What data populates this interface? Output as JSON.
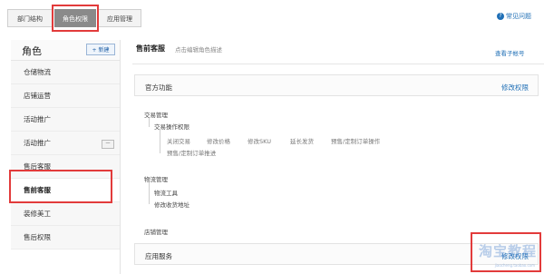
{
  "tabs": [
    "部门结构",
    "角色权限",
    "应用管理"
  ],
  "help_text": "常见问题",
  "sidebar": {
    "title": "角色",
    "new_button": "+ 新建",
    "items": [
      {
        "label": "仓储物流"
      },
      {
        "label": "店铺运营"
      },
      {
        "label": "活动推广"
      },
      {
        "label": "活动推广",
        "mini": "一"
      },
      {
        "label": "售后客服"
      },
      {
        "label": "售前客服"
      },
      {
        "label": "装修美工"
      },
      {
        "label": "售后权限"
      }
    ]
  },
  "main": {
    "title": "售前客服",
    "desc": "点击编辑角色描述",
    "view_sub": "查看子帐号",
    "official": {
      "label": "官方功能",
      "link": "修改权限"
    },
    "trade": {
      "group": "交易管理",
      "sub": "交易操作权限",
      "row1": [
        "关闭交易",
        "修改价格",
        "修改SKU",
        "延长发货",
        "预售/定制订单操作"
      ],
      "row2": "预售/定制订单推进"
    },
    "logistics": {
      "group": "物流管理",
      "items": [
        "物流工具",
        "修改收货地址"
      ]
    },
    "shop": {
      "group": "店铺管理"
    },
    "apps": {
      "label": "应用服务",
      "link": "修改权限"
    }
  },
  "watermark": {
    "main": "淘宝教程",
    "sub": "jiaocheng.taobao.com"
  }
}
